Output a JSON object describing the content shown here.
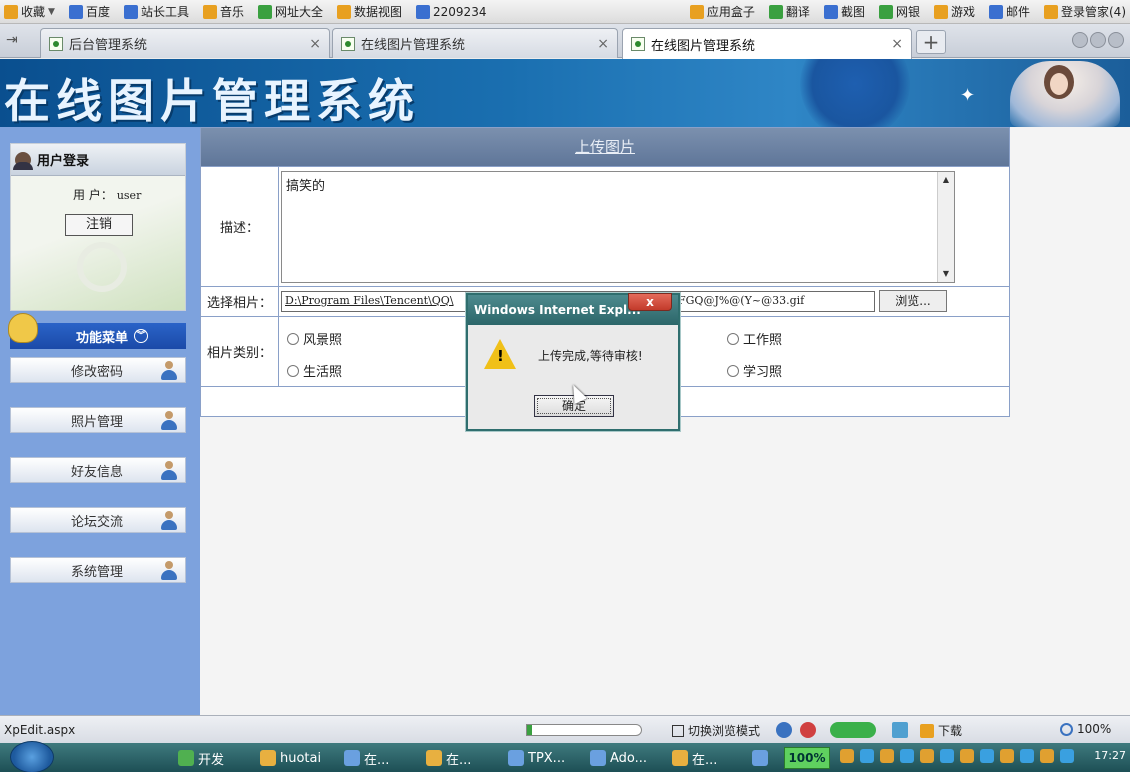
{
  "favorites_bar": {
    "items": [
      {
        "label": "收藏",
        "icon": "star-icon"
      },
      {
        "label": "百度",
        "icon": "baidu-icon"
      },
      {
        "label": "站长工具",
        "icon": "tool-icon"
      },
      {
        "label": "音乐",
        "icon": "music-icon"
      },
      {
        "label": "网址大全",
        "icon": "site-icon"
      },
      {
        "label": "数据视图",
        "icon": "data-icon"
      },
      {
        "label": "2209234",
        "icon": "qq-icon"
      }
    ],
    "right_items": [
      {
        "label": "应用盒子"
      },
      {
        "label": "翻译"
      },
      {
        "label": "截图"
      },
      {
        "label": "网银"
      },
      {
        "label": "游戏"
      },
      {
        "label": "邮件"
      },
      {
        "label": "登录管家(4)"
      }
    ]
  },
  "tabs": [
    {
      "label": "后台管理系统",
      "active": false
    },
    {
      "label": "在线图片管理系统",
      "active": false
    },
    {
      "label": "在线图片管理系统",
      "active": true
    }
  ],
  "tab_close_glyph": "×",
  "new_tab_glyph": "+",
  "banner": {
    "title": "在线图片管理系统"
  },
  "sidebar": {
    "login_title": "用户登录",
    "user_label": "用 户：",
    "user_value": "user",
    "logout_label": "注销",
    "menu_title": "功能菜单",
    "menu_items": [
      {
        "label": "修改密码"
      },
      {
        "label": "照片管理"
      },
      {
        "label": "好友信息"
      },
      {
        "label": "论坛交流"
      },
      {
        "label": "系统管理"
      }
    ]
  },
  "form": {
    "header": "上传图片",
    "desc_label": "描述：",
    "desc_value": "搞笑的",
    "file_label": "选择相片：",
    "file_value_start": "D:\\Program Files\\Tencent\\QQ\\",
    "file_value_end": "FGQ@J%@(Y~@33.gif",
    "browse_label": "浏览...",
    "category_label": "相片类别：",
    "categories": [
      {
        "label": "风景照"
      },
      {
        "label": "工作照"
      },
      {
        "label": "生活照"
      },
      {
        "label": "学习照"
      }
    ]
  },
  "dialog": {
    "title": "Windows Internet Expl...",
    "message": "上传完成,等待审核!",
    "ok_label": "确定",
    "close_glyph": "x"
  },
  "status_bar": {
    "url": "XpEdit.aspx",
    "progress_fraction": 0.04,
    "mode_label": "切换浏览模式",
    "download_label": "下载",
    "zoom": "100%"
  },
  "taskbar": {
    "items": [
      {
        "label": "开发"
      },
      {
        "label": "huotai"
      },
      {
        "label": "在..."
      },
      {
        "label": "在..."
      },
      {
        "label": "TPX..."
      },
      {
        "label": "Ado..."
      },
      {
        "label": "在..."
      }
    ],
    "tray_percent": "100%",
    "clock": "17:27"
  }
}
